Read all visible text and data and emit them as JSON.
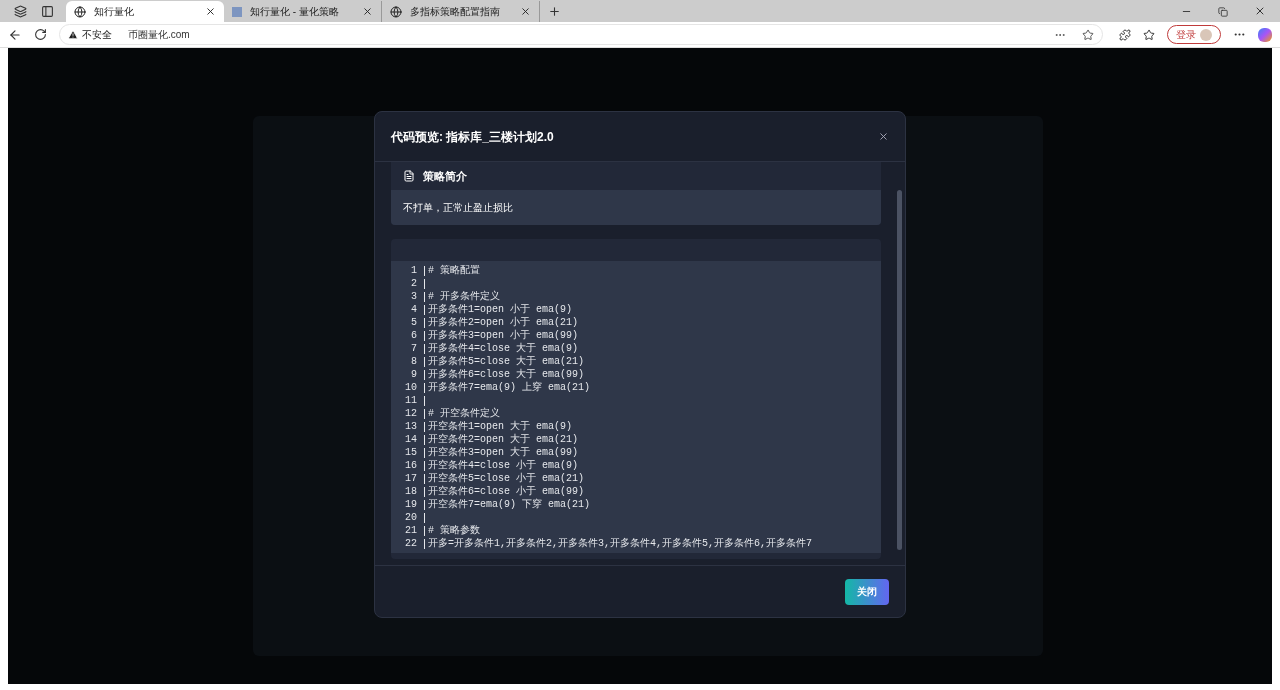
{
  "browser": {
    "tabs": [
      {
        "title": "知行量化",
        "selected": true,
        "kind": "globe"
      },
      {
        "title": "知行量化 - 量化策略",
        "selected": false,
        "kind": "favicon"
      },
      {
        "title": "多指标策略配置指南",
        "selected": false,
        "kind": "globe"
      }
    ],
    "security": "不安全",
    "address": "币圈量化.com",
    "login": "登录"
  },
  "modal": {
    "title": "代码预览: 指标库_三楼计划2.0",
    "intro": {
      "heading": "策略简介",
      "text": "不打单，正常止盈止损比"
    },
    "code_lines": [
      {
        "number": "1",
        "text": "# 策略配置"
      },
      {
        "number": "2"
      },
      {
        "number": "3",
        "text": "# 开多条件定义"
      },
      {
        "number": "4",
        "text": "开多条件1=open 小于 ema(9)"
      },
      {
        "number": "5",
        "text": "开多条件2=open 小于 ema(21)"
      },
      {
        "number": "6",
        "text": "开多条件3=open 小于 ema(99)"
      },
      {
        "number": "7",
        "text": "开多条件4=close 大于 ema(9)"
      },
      {
        "number": "8",
        "text": "开多条件5=close 大于 ema(21)"
      },
      {
        "number": "9",
        "text": "开多条件6=close 大于 ema(99)"
      },
      {
        "number": "10",
        "text": "开多条件7=ema(9) 上穿 ema(21)"
      },
      {
        "number": "11"
      },
      {
        "number": "12",
        "text": "# 开空条件定义"
      },
      {
        "number": "13",
        "text": "开空条件1=open 大于 ema(9)"
      },
      {
        "number": "14",
        "text": "开空条件2=open 大于 ema(21)"
      },
      {
        "number": "15",
        "text": "开空条件3=open 大于 ema(99)"
      },
      {
        "number": "16",
        "text": "开空条件4=close 小于 ema(9)"
      },
      {
        "number": "17",
        "text": "开空条件5=close 小于 ema(21)"
      },
      {
        "number": "18",
        "text": "开空条件6=close 小于 ema(99)"
      },
      {
        "number": "19",
        "text": "开空条件7=ema(9) 下穿 ema(21)"
      },
      {
        "number": "20"
      },
      {
        "number": "21",
        "text": "# 策略参数"
      },
      {
        "number": "22",
        "text": "开多=开多条件1,开多条件2,开多条件3,开多条件4,开多条件5,开多条件6,开多条件7"
      }
    ],
    "close_button": "关闭"
  }
}
